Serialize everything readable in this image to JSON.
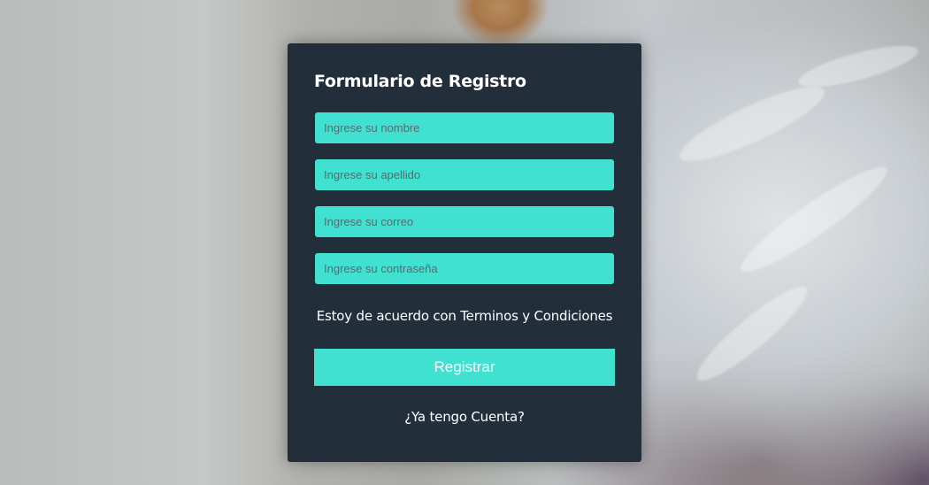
{
  "form": {
    "title": "Formulario de Registro",
    "fields": [
      {
        "name": "nombre",
        "placeholder": "Ingrese su nombre",
        "value": ""
      },
      {
        "name": "apellido",
        "placeholder": "Ingrese su apellido",
        "value": ""
      },
      {
        "name": "correo",
        "placeholder": "Ingrese su correo",
        "value": ""
      },
      {
        "name": "contrasena",
        "placeholder": "Ingrese su contraseña",
        "value": ""
      }
    ],
    "terms_text": "Estoy de acuerdo con Terminos y Condiciones",
    "submit_label": "Registrar",
    "login_link_text": "¿Ya tengo Cuenta?"
  },
  "colors": {
    "card_background": "#232e3b",
    "accent": "#40e1d1",
    "text": "#ffffff"
  }
}
